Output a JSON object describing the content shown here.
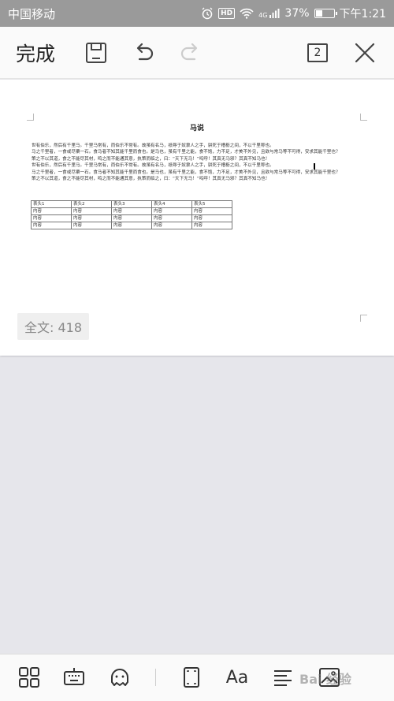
{
  "status_bar": {
    "carrier": "中国移动",
    "hd": "HD",
    "network": "4G",
    "battery": "37%",
    "battery_level": 0.37,
    "time": "下午1:21"
  },
  "toolbar": {
    "done_label": "完成",
    "page_count": "2"
  },
  "document": {
    "title": "马说",
    "paragraphs": [
      "世有伯乐，然后有千里马。千里马常有，而伯乐不常有。故虽有名马，祇辱于奴隶人之手，骈死于槽枥之间，不以千里称也。",
      "马之千里者，一食或尽粟一石。食马者不知其能千里而食也。是马也，虽有千里之能，食不饱，力不足，才美不外见，且欲与常马等不可得，安求其能千里也？",
      "策之不以其道，食之不能尽其材，鸣之而不能通其意，执策而临之，曰：“天下无马！”呜呼！其真无马邪？其真不知马也！",
      "世有伯乐，然后有千里马。千里马常有，而伯乐不常有。故虽有名马，祇辱于奴隶人之手，骈死于槽枥之间，不以千里称也。",
      "马之千里者，一食或尽粟一石。食马者不知其能千里而食也。是马也，虽有千里之能，食不饱，力不足，才美不外见，且欲与常马等不可得，安求其能千里也？",
      "策之不以其道，食之不能尽其材，鸣之而不能通其意，执策而临之，曰：“天下无马！”呜呼！其真无马邪？其真不知马也！"
    ],
    "table": {
      "headers": [
        "表头1",
        "表头2",
        "表头3",
        "表头4",
        "表头5"
      ],
      "rows": [
        [
          "内容",
          "内容",
          "内容",
          "内容",
          "内容"
        ],
        [
          "内容",
          "内容",
          "内容",
          "内容",
          "内容"
        ],
        [
          "内容",
          "内容",
          "内容",
          "内容",
          "内容"
        ]
      ]
    },
    "word_count": "全文: 418"
  },
  "bottom_bar": {
    "font_label": "Aa",
    "watermark": "Bai 经验"
  },
  "icons": {
    "save": "save-icon",
    "undo": "undo-icon",
    "redo": "redo-icon",
    "close": "close-icon",
    "apps": "apps-grid-icon",
    "keyboard": "keyboard-icon",
    "emoji": "emoji-icon",
    "fullscreen": "fullscreen-icon",
    "align": "align-icon",
    "image": "image-icon"
  }
}
